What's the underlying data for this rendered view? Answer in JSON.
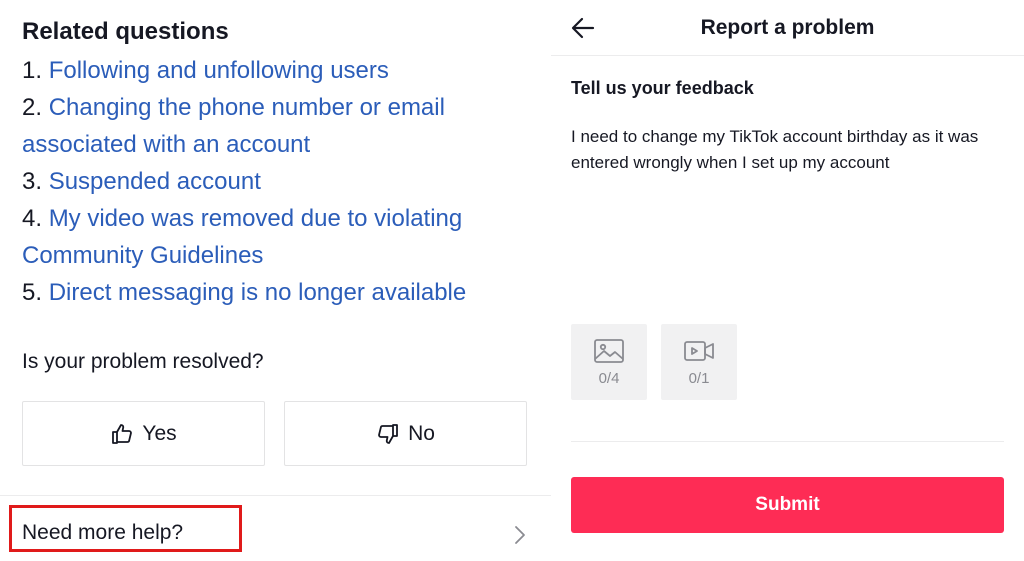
{
  "left": {
    "related_title": "Related questions",
    "related_questions": [
      {
        "num": "1.",
        "text": "Following and unfollowing users"
      },
      {
        "num": "2.",
        "text": "Changing the phone number or email associated with an account"
      },
      {
        "num": "3.",
        "text": "Suspended account"
      },
      {
        "num": "4.",
        "text": "My video was removed due to violating Community Guidelines"
      },
      {
        "num": "5.",
        "text": "Direct messaging is no longer available"
      }
    ],
    "resolved_question": "Is your problem resolved?",
    "yes_label": "Yes",
    "no_label": "No",
    "more_help_label": "Need more help?"
  },
  "right": {
    "title": "Report a problem",
    "feedback_label": "Tell us your feedback",
    "feedback_text": "I need to change my TikTok account birthday as it was entered wrongly when I set up my account",
    "image_count": "0/4",
    "video_count": "0/1",
    "submit_label": "Submit"
  },
  "icons": {
    "back": "arrow-left-icon",
    "thumbs_up": "thumbs-up-icon",
    "thumbs_down": "thumbs-down-icon",
    "chevron": "chevron-right-icon",
    "image": "image-icon",
    "video": "video-camera-icon"
  },
  "colors": {
    "link": "#2b5db9",
    "submit": "#fe2c55",
    "highlight": "#e01a1a",
    "text": "#161823"
  }
}
